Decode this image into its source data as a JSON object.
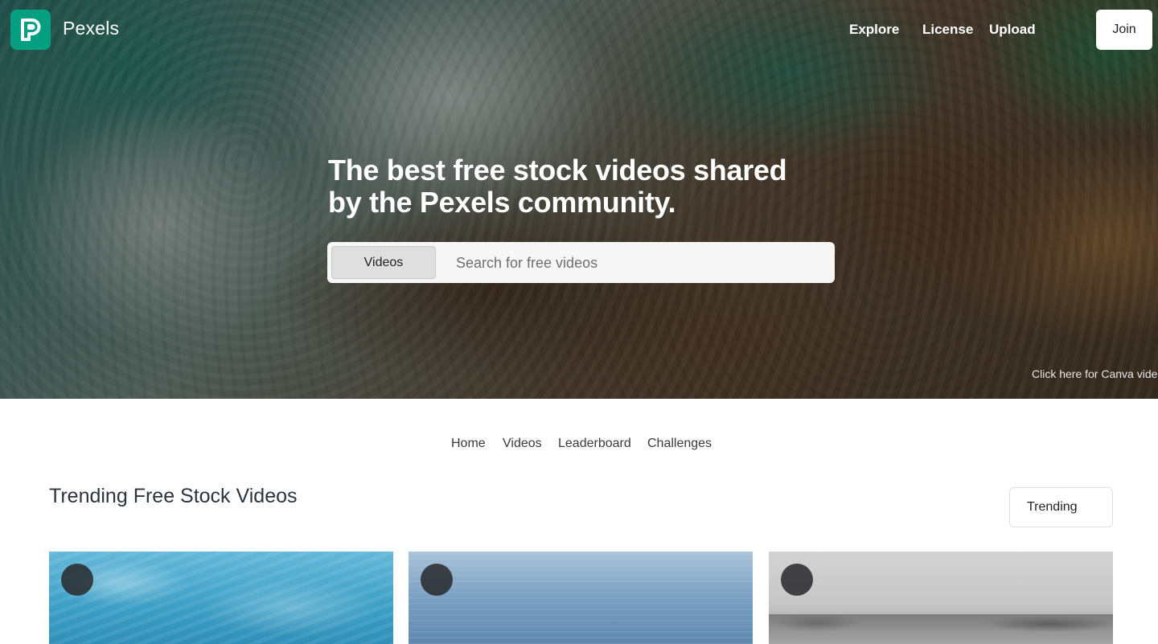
{
  "header": {
    "brand": "Pexels",
    "nav": [
      {
        "label": "Explore"
      },
      {
        "label": "License"
      },
      {
        "label": "Upload"
      }
    ],
    "join_label": "Join"
  },
  "hero": {
    "headline": "The best free stock videos shared by the Pexels community.",
    "search": {
      "type_label": "Videos",
      "placeholder": "Search for free videos"
    },
    "canva_link": "Click here for Canva video"
  },
  "subnav": [
    {
      "label": "Home"
    },
    {
      "label": "Videos"
    },
    {
      "label": "Leaderboard"
    },
    {
      "label": "Challenges"
    }
  ],
  "section": {
    "title": "Trending Free Stock Videos",
    "sort_label": "Trending"
  },
  "colors": {
    "brand": "#05a081",
    "text": "#2c343e"
  },
  "icons": {
    "logo": "pexels-logo-icon",
    "avatar": "user-avatar"
  }
}
